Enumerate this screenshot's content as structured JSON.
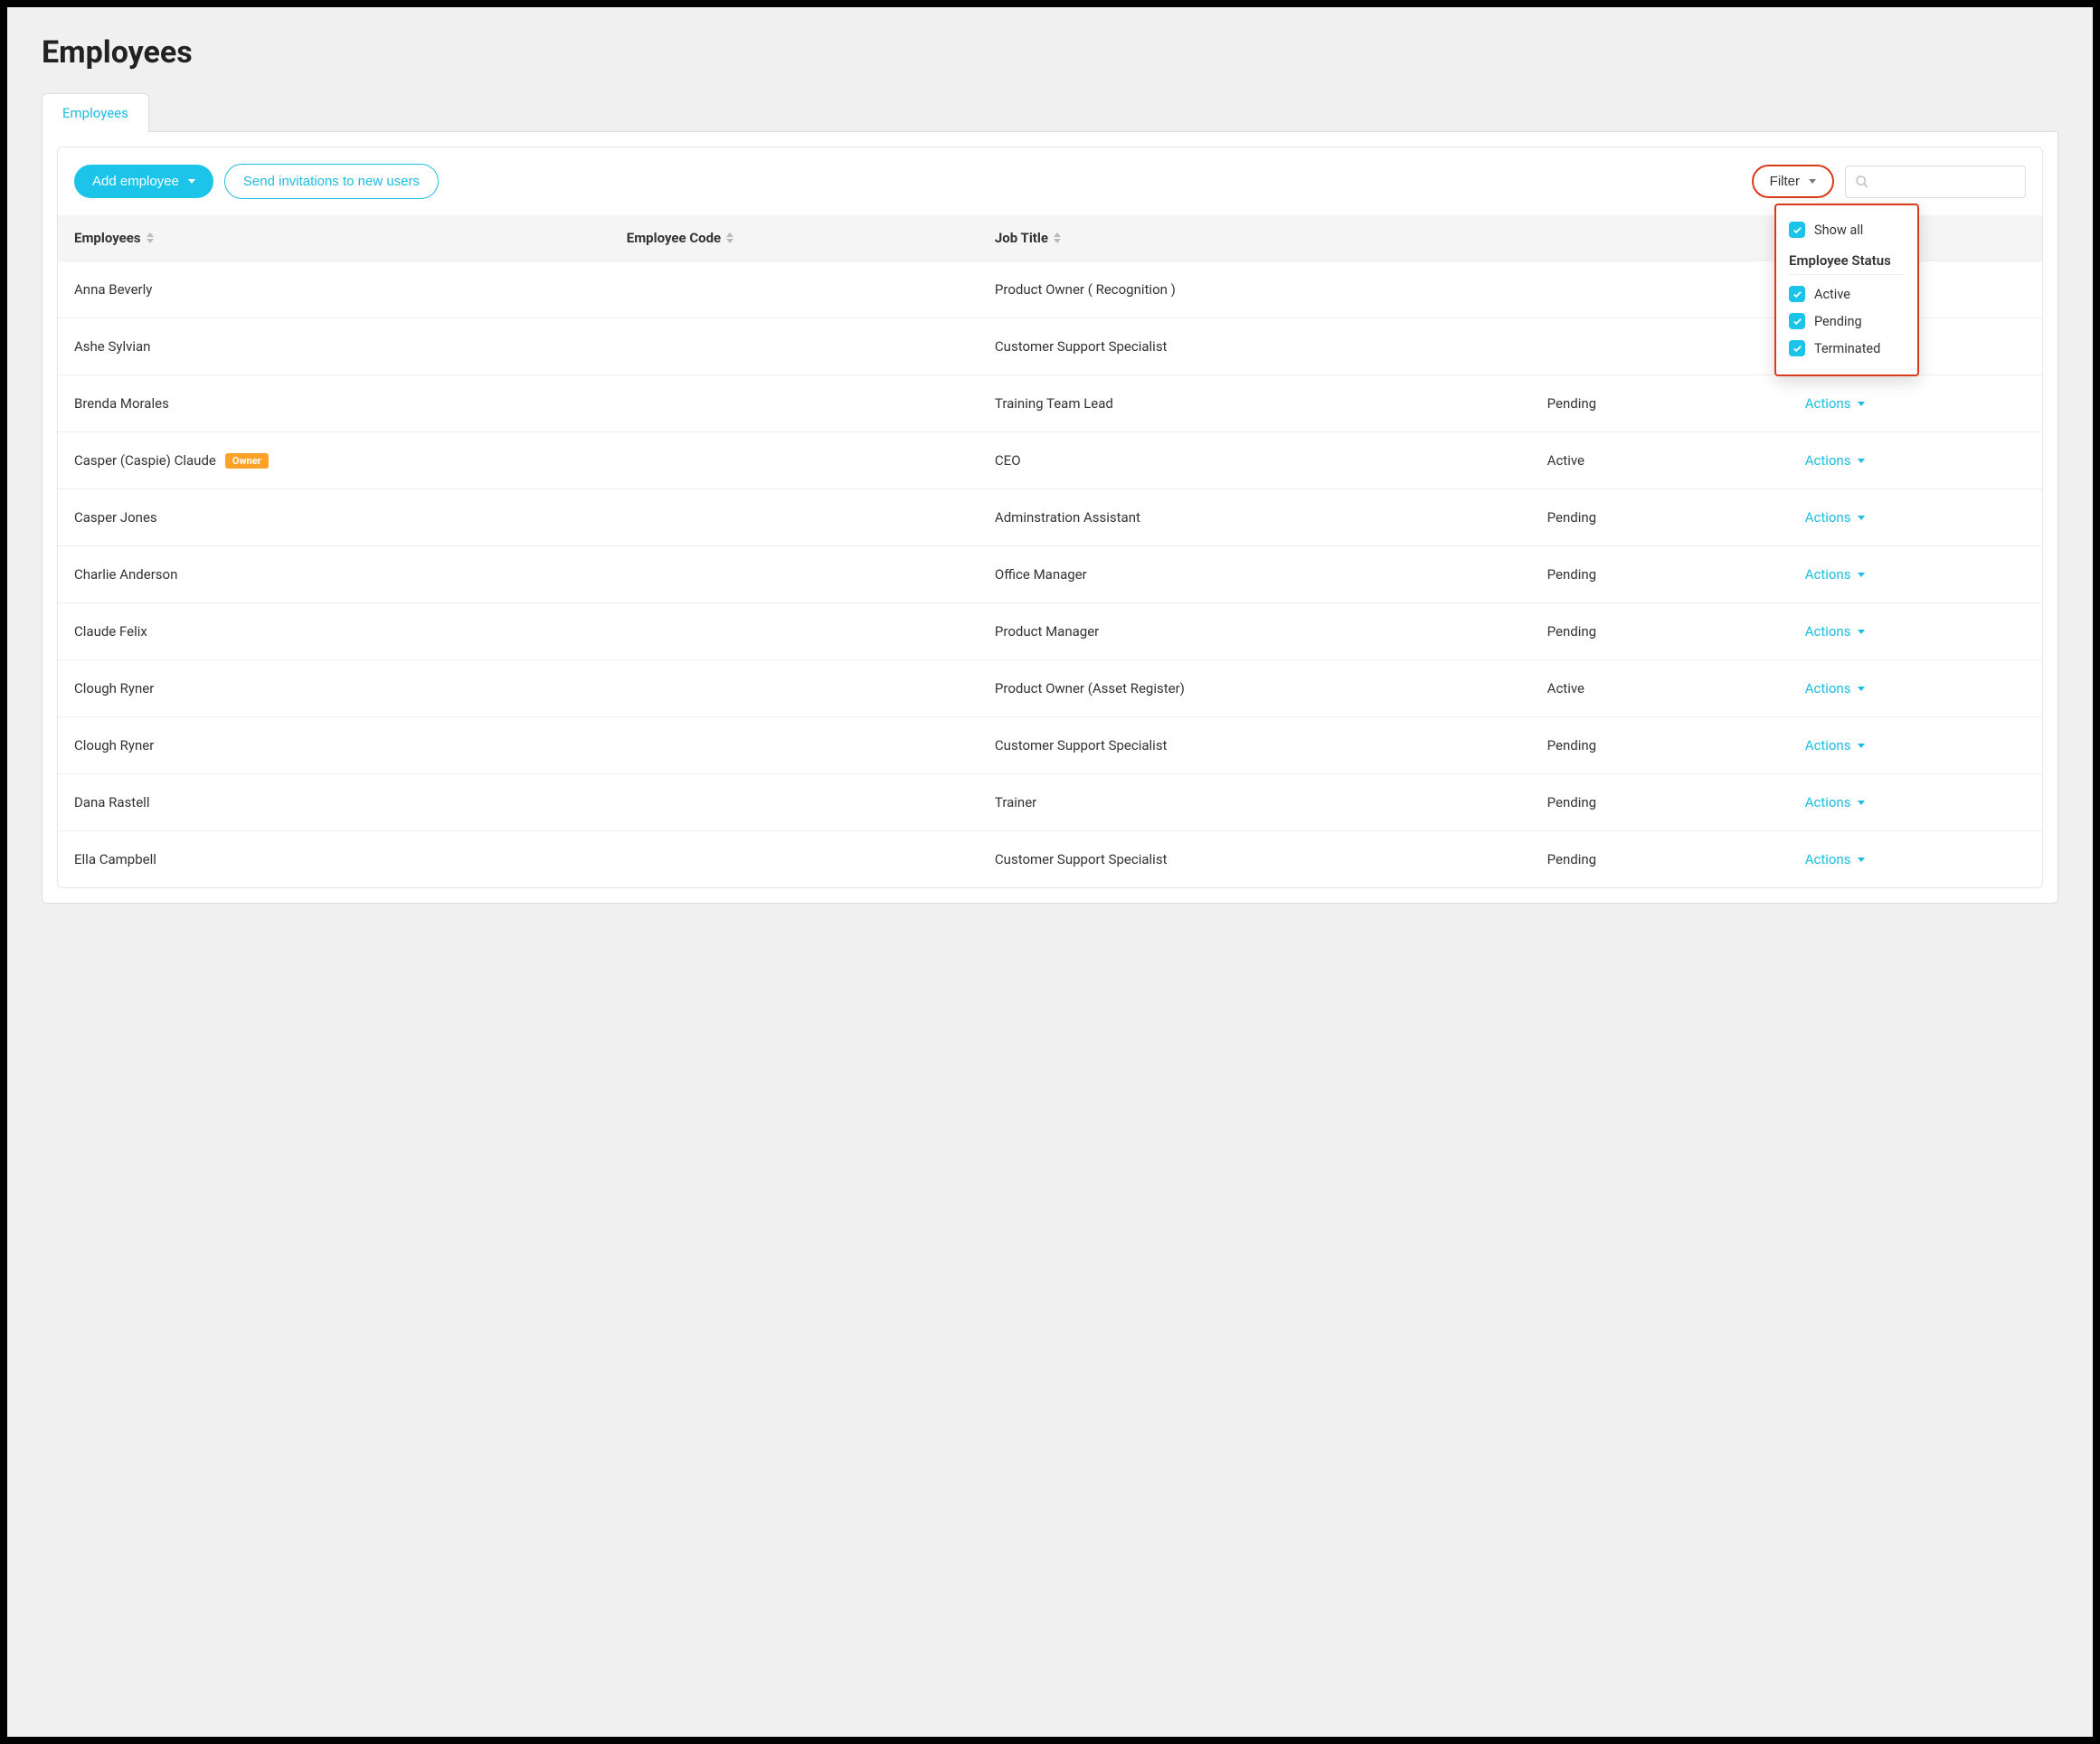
{
  "page": {
    "title": "Employees"
  },
  "tabs": [
    {
      "label": "Employees",
      "active": true
    }
  ],
  "toolbar": {
    "add_employee_label": "Add employee",
    "send_invitations_label": "Send invitations to new users",
    "filter_label": "Filter",
    "search_placeholder": ""
  },
  "filter_panel": {
    "show_all_label": "Show all",
    "group_title": "Employee Status",
    "options": [
      {
        "label": "Active",
        "checked": true
      },
      {
        "label": "Pending",
        "checked": true
      },
      {
        "label": "Terminated",
        "checked": true
      }
    ]
  },
  "table": {
    "columns": {
      "employees": "Employees",
      "employee_code": "Employee Code",
      "job_title": "Job Title",
      "status": "",
      "actions": "Actions"
    },
    "actions_label": "Actions",
    "owner_badge_label": "Owner",
    "rows": [
      {
        "name": "Anna Beverly",
        "code": "",
        "job_title": "Product Owner ( Recognition )",
        "status": "",
        "owner": false
      },
      {
        "name": "Ashe Sylvian",
        "code": "",
        "job_title": "Customer Support Specialist",
        "status": "",
        "owner": false
      },
      {
        "name": "Brenda Morales",
        "code": "",
        "job_title": "Training Team Lead",
        "status": "Pending",
        "owner": false
      },
      {
        "name": "Casper (Caspie) Claude",
        "code": "",
        "job_title": "CEO",
        "status": "Active",
        "owner": true
      },
      {
        "name": "Casper Jones",
        "code": "",
        "job_title": "Adminstration Assistant",
        "status": "Pending",
        "owner": false
      },
      {
        "name": "Charlie Anderson",
        "code": "",
        "job_title": "Office Manager",
        "status": "Pending",
        "owner": false
      },
      {
        "name": "Claude Felix",
        "code": "",
        "job_title": "Product Manager",
        "status": "Pending",
        "owner": false
      },
      {
        "name": "Clough Ryner",
        "code": "",
        "job_title": "Product Owner (Asset Register)",
        "status": "Active",
        "owner": false
      },
      {
        "name": "Clough Ryner",
        "code": "",
        "job_title": "Customer Support Specialist",
        "status": "Pending",
        "owner": false
      },
      {
        "name": "Dana Rastell",
        "code": "",
        "job_title": "Trainer",
        "status": "Pending",
        "owner": false
      },
      {
        "name": "Ella Campbell",
        "code": "",
        "job_title": "Customer Support Specialist",
        "status": "Pending",
        "owner": false
      }
    ]
  },
  "colors": {
    "accent": "#1bc4e8",
    "link": "#1bbde0",
    "highlight_border": "#d93b1a",
    "owner_badge": "#ffa227"
  }
}
